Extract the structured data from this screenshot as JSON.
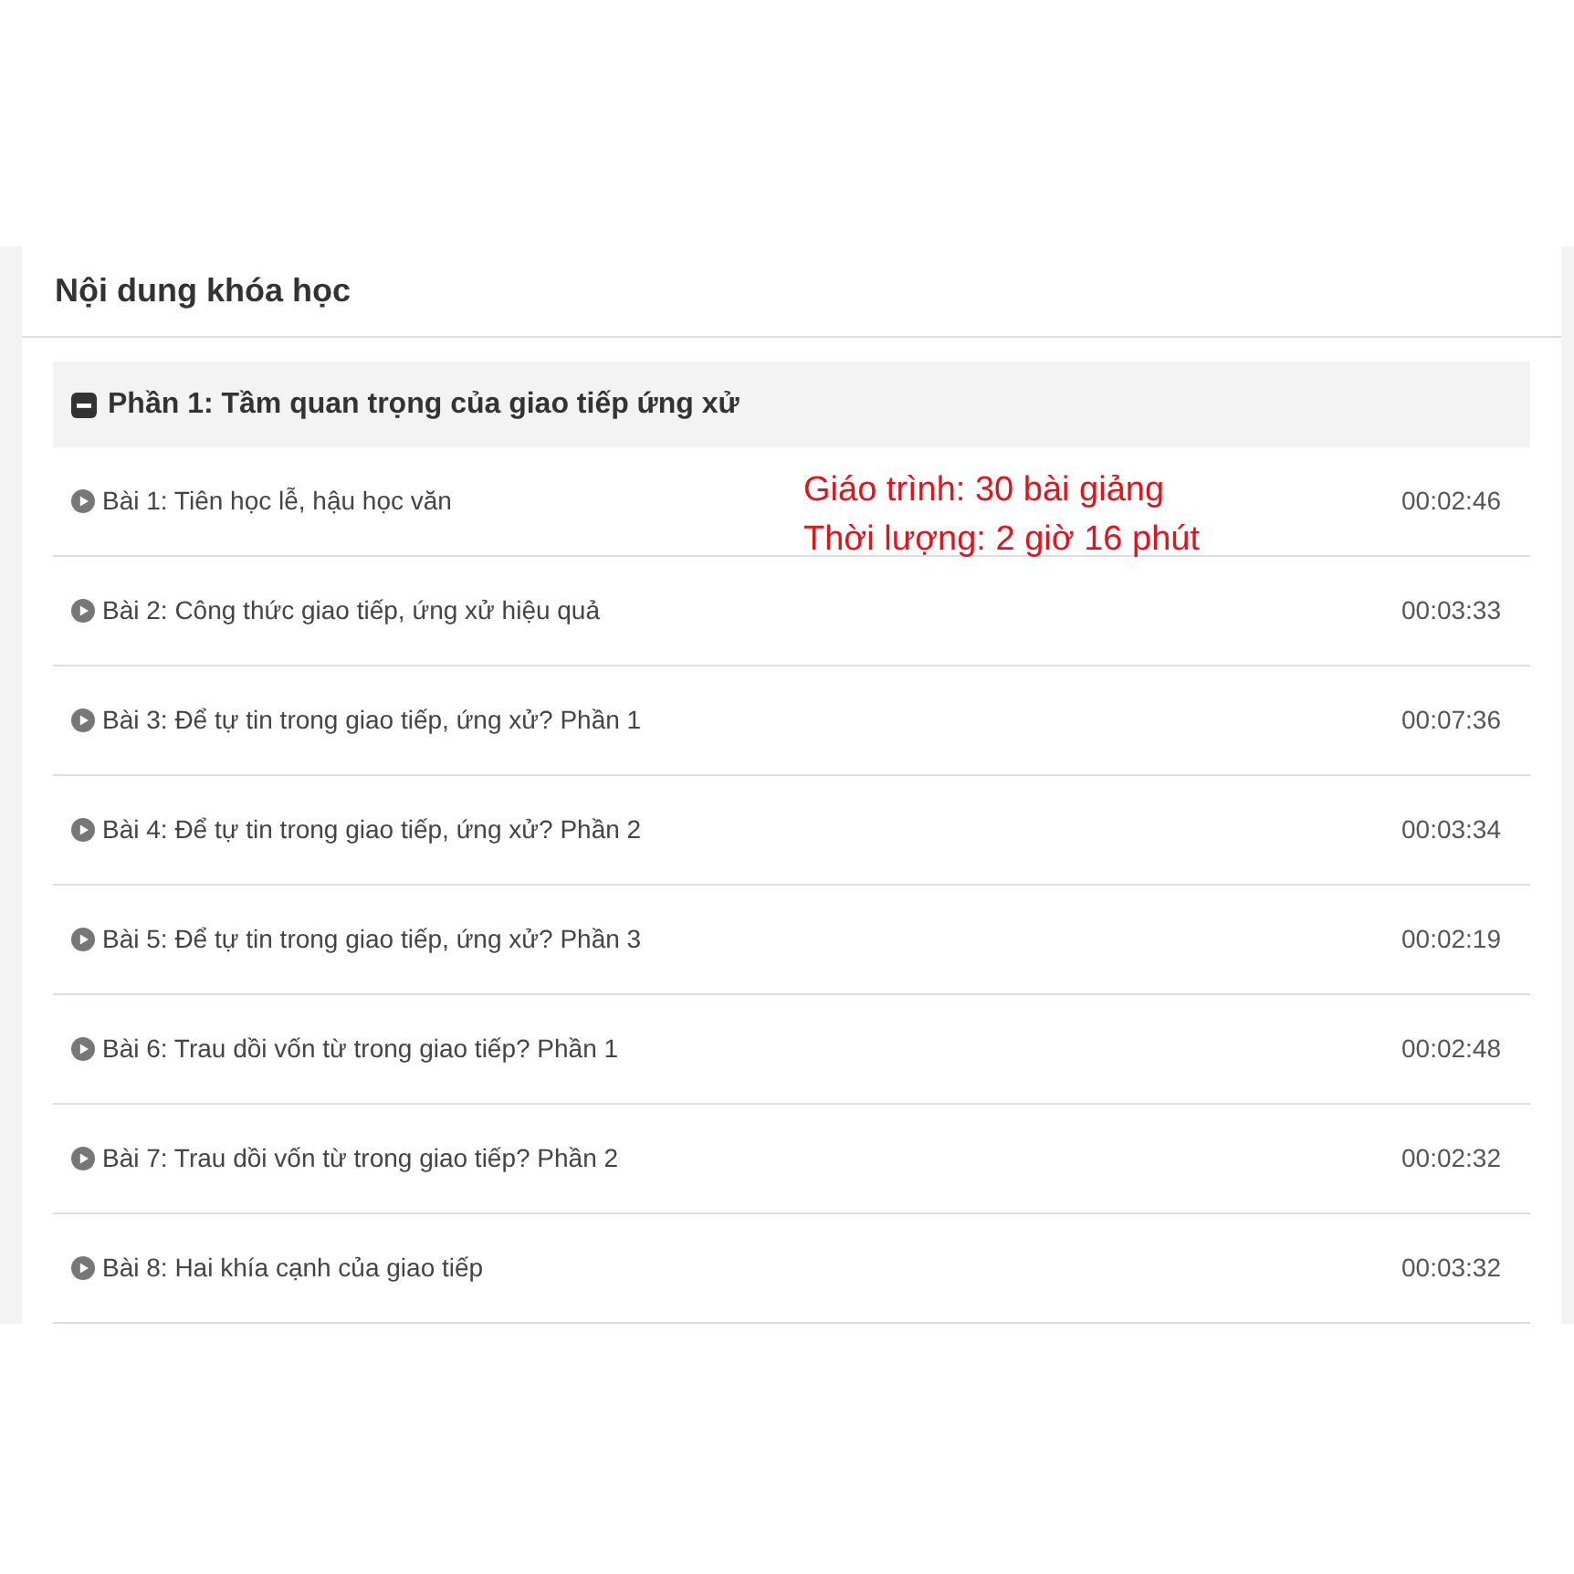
{
  "card": {
    "title": "Nội dung khóa học"
  },
  "sections": [
    {
      "title": "Phần 1: Tầm quan trọng của giao tiếp ứng xử",
      "expanded": true,
      "lessons": [
        {
          "title": "Bài 1: Tiên học lễ, hậu học văn",
          "duration": "00:02:46"
        },
        {
          "title": "Bài 2: Công thức giao tiếp, ứng xử hiệu quả",
          "duration": "00:03:33"
        },
        {
          "title": "Bài 3: Để tự tin trong giao tiếp, ứng xử? Phần 1",
          "duration": "00:07:36"
        },
        {
          "title": "Bài 4: Để tự tin trong giao tiếp, ứng xử? Phần 2",
          "duration": "00:03:34"
        },
        {
          "title": "Bài 5: Để tự tin trong giao tiếp, ứng xử? Phần 3",
          "duration": "00:02:19"
        },
        {
          "title": "Bài 6: Trau dồi vốn từ trong giao tiếp? Phần 1",
          "duration": "00:02:48"
        },
        {
          "title": "Bài 7: Trau dồi vốn từ trong giao tiếp? Phần 2",
          "duration": "00:02:32"
        },
        {
          "title": "Bài 8: Hai khía cạnh của giao tiếp",
          "duration": "00:03:32"
        }
      ]
    }
  ],
  "annotation": [
    "Giáo trình: 30 bài giảng",
    "Thời lượng: 2 giờ 16 phút"
  ]
}
